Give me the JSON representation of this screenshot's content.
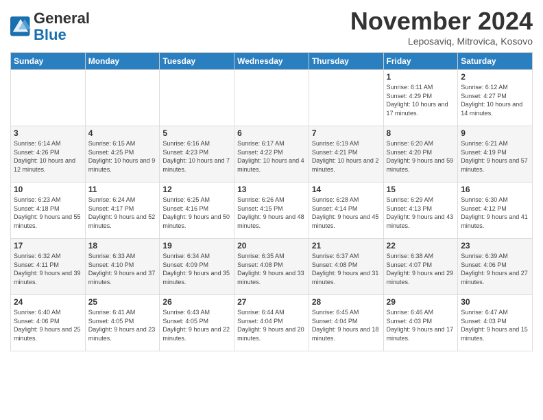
{
  "logo": {
    "text_general": "General",
    "text_blue": "Blue"
  },
  "title": "November 2024",
  "location": "Leposaviq, Mitrovica, Kosovo",
  "days_of_week": [
    "Sunday",
    "Monday",
    "Tuesday",
    "Wednesday",
    "Thursday",
    "Friday",
    "Saturday"
  ],
  "weeks": [
    [
      {
        "day": "",
        "info": ""
      },
      {
        "day": "",
        "info": ""
      },
      {
        "day": "",
        "info": ""
      },
      {
        "day": "",
        "info": ""
      },
      {
        "day": "",
        "info": ""
      },
      {
        "day": "1",
        "info": "Sunrise: 6:11 AM\nSunset: 4:29 PM\nDaylight: 10 hours and 17 minutes."
      },
      {
        "day": "2",
        "info": "Sunrise: 6:12 AM\nSunset: 4:27 PM\nDaylight: 10 hours and 14 minutes."
      }
    ],
    [
      {
        "day": "3",
        "info": "Sunrise: 6:14 AM\nSunset: 4:26 PM\nDaylight: 10 hours and 12 minutes."
      },
      {
        "day": "4",
        "info": "Sunrise: 6:15 AM\nSunset: 4:25 PM\nDaylight: 10 hours and 9 minutes."
      },
      {
        "day": "5",
        "info": "Sunrise: 6:16 AM\nSunset: 4:23 PM\nDaylight: 10 hours and 7 minutes."
      },
      {
        "day": "6",
        "info": "Sunrise: 6:17 AM\nSunset: 4:22 PM\nDaylight: 10 hours and 4 minutes."
      },
      {
        "day": "7",
        "info": "Sunrise: 6:19 AM\nSunset: 4:21 PM\nDaylight: 10 hours and 2 minutes."
      },
      {
        "day": "8",
        "info": "Sunrise: 6:20 AM\nSunset: 4:20 PM\nDaylight: 9 hours and 59 minutes."
      },
      {
        "day": "9",
        "info": "Sunrise: 6:21 AM\nSunset: 4:19 PM\nDaylight: 9 hours and 57 minutes."
      }
    ],
    [
      {
        "day": "10",
        "info": "Sunrise: 6:23 AM\nSunset: 4:18 PM\nDaylight: 9 hours and 55 minutes."
      },
      {
        "day": "11",
        "info": "Sunrise: 6:24 AM\nSunset: 4:17 PM\nDaylight: 9 hours and 52 minutes."
      },
      {
        "day": "12",
        "info": "Sunrise: 6:25 AM\nSunset: 4:16 PM\nDaylight: 9 hours and 50 minutes."
      },
      {
        "day": "13",
        "info": "Sunrise: 6:26 AM\nSunset: 4:15 PM\nDaylight: 9 hours and 48 minutes."
      },
      {
        "day": "14",
        "info": "Sunrise: 6:28 AM\nSunset: 4:14 PM\nDaylight: 9 hours and 45 minutes."
      },
      {
        "day": "15",
        "info": "Sunrise: 6:29 AM\nSunset: 4:13 PM\nDaylight: 9 hours and 43 minutes."
      },
      {
        "day": "16",
        "info": "Sunrise: 6:30 AM\nSunset: 4:12 PM\nDaylight: 9 hours and 41 minutes."
      }
    ],
    [
      {
        "day": "17",
        "info": "Sunrise: 6:32 AM\nSunset: 4:11 PM\nDaylight: 9 hours and 39 minutes."
      },
      {
        "day": "18",
        "info": "Sunrise: 6:33 AM\nSunset: 4:10 PM\nDaylight: 9 hours and 37 minutes."
      },
      {
        "day": "19",
        "info": "Sunrise: 6:34 AM\nSunset: 4:09 PM\nDaylight: 9 hours and 35 minutes."
      },
      {
        "day": "20",
        "info": "Sunrise: 6:35 AM\nSunset: 4:08 PM\nDaylight: 9 hours and 33 minutes."
      },
      {
        "day": "21",
        "info": "Sunrise: 6:37 AM\nSunset: 4:08 PM\nDaylight: 9 hours and 31 minutes."
      },
      {
        "day": "22",
        "info": "Sunrise: 6:38 AM\nSunset: 4:07 PM\nDaylight: 9 hours and 29 minutes."
      },
      {
        "day": "23",
        "info": "Sunrise: 6:39 AM\nSunset: 4:06 PM\nDaylight: 9 hours and 27 minutes."
      }
    ],
    [
      {
        "day": "24",
        "info": "Sunrise: 6:40 AM\nSunset: 4:06 PM\nDaylight: 9 hours and 25 minutes."
      },
      {
        "day": "25",
        "info": "Sunrise: 6:41 AM\nSunset: 4:05 PM\nDaylight: 9 hours and 23 minutes."
      },
      {
        "day": "26",
        "info": "Sunrise: 6:43 AM\nSunset: 4:05 PM\nDaylight: 9 hours and 22 minutes."
      },
      {
        "day": "27",
        "info": "Sunrise: 6:44 AM\nSunset: 4:04 PM\nDaylight: 9 hours and 20 minutes."
      },
      {
        "day": "28",
        "info": "Sunrise: 6:45 AM\nSunset: 4:04 PM\nDaylight: 9 hours and 18 minutes."
      },
      {
        "day": "29",
        "info": "Sunrise: 6:46 AM\nSunset: 4:03 PM\nDaylight: 9 hours and 17 minutes."
      },
      {
        "day": "30",
        "info": "Sunrise: 6:47 AM\nSunset: 4:03 PM\nDaylight: 9 hours and 15 minutes."
      }
    ]
  ]
}
